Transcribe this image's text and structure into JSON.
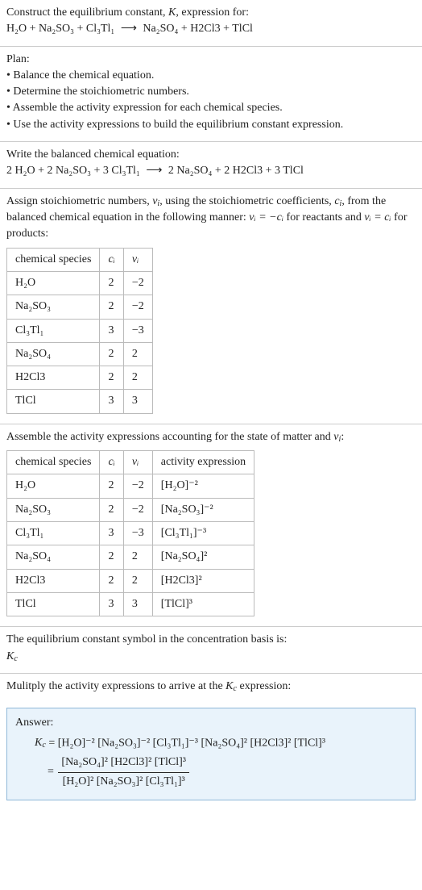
{
  "intro": {
    "line1_a": "Construct the equilibrium constant, ",
    "line1_k": "K",
    "line1_b": ", expression for:",
    "reaction_lhs": "H₂O + Na₂SO₃ + Cl₃Tl₁",
    "arrow": "⟶",
    "reaction_rhs": "Na₂SO₄ + H2Cl3 + TlCl"
  },
  "plan": {
    "title": "Plan:",
    "b1": "• Balance the chemical equation.",
    "b2": "• Determine the stoichiometric numbers.",
    "b3": "• Assemble the activity expression for each chemical species.",
    "b4": "• Use the activity expressions to build the equilibrium constant expression."
  },
  "balanced": {
    "title": "Write the balanced chemical equation:",
    "lhs": "2 H₂O + 2 Na₂SO₃ + 3 Cl₃Tl₁",
    "arrow": "⟶",
    "rhs": "2 Na₂SO₄ + 2 H2Cl3 + 3 TlCl"
  },
  "assign": {
    "line1_a": "Assign stoichiometric numbers, ",
    "line1_nu": "ν",
    "line1_i": "i",
    "line1_b": ", using the stoichiometric coefficients, ",
    "line1_c": "c",
    "line1_d": ", from the balanced chemical equation in the following manner: ",
    "rel1": "νᵢ = −cᵢ",
    "line1_e": " for reactants and ",
    "rel2": "νᵢ = cᵢ",
    "line1_f": " for products:",
    "headers": {
      "sp": "chemical species",
      "c": "cᵢ",
      "nu": "νᵢ"
    },
    "rows": [
      {
        "sp": "H₂O",
        "c": "2",
        "nu": "−2"
      },
      {
        "sp": "Na₂SO₃",
        "c": "2",
        "nu": "−2"
      },
      {
        "sp": "Cl₃Tl₁",
        "c": "3",
        "nu": "−3"
      },
      {
        "sp": "Na₂SO₄",
        "c": "2",
        "nu": "2"
      },
      {
        "sp": "H2Cl3",
        "c": "2",
        "nu": "2"
      },
      {
        "sp": "TlCl",
        "c": "3",
        "nu": "3"
      }
    ]
  },
  "activity": {
    "title_a": "Assemble the activity expressions accounting for the state of matter and ",
    "title_nu": "ν",
    "title_i": "i",
    "title_b": ":",
    "headers": {
      "sp": "chemical species",
      "c": "cᵢ",
      "nu": "νᵢ",
      "act": "activity expression"
    },
    "rows": [
      {
        "sp": "H₂O",
        "c": "2",
        "nu": "−2",
        "act": "[H₂O]⁻²"
      },
      {
        "sp": "Na₂SO₃",
        "c": "2",
        "nu": "−2",
        "act": "[Na₂SO₃]⁻²"
      },
      {
        "sp": "Cl₃Tl₁",
        "c": "3",
        "nu": "−3",
        "act": "[Cl₃Tl₁]⁻³"
      },
      {
        "sp": "Na₂SO₄",
        "c": "2",
        "nu": "2",
        "act": "[Na₂SO₄]²"
      },
      {
        "sp": "H2Cl3",
        "c": "2",
        "nu": "2",
        "act": "[H2Cl3]²"
      },
      {
        "sp": "TlCl",
        "c": "3",
        "nu": "3",
        "act": "[TlCl]³"
      }
    ]
  },
  "kc_symbol": {
    "line": "The equilibrium constant symbol in the concentration basis is:",
    "kc_k": "K",
    "kc_c": "c"
  },
  "multiply": {
    "line_a": "Mulitply the activity expressions to arrive at the ",
    "kc_k": "K",
    "kc_c": "c",
    "line_b": " expression:"
  },
  "answer": {
    "title": "Answer:",
    "lhs_k": "K",
    "lhs_c": "c",
    "eq": " = ",
    "long": "[H₂O]⁻² [Na₂SO₃]⁻² [Cl₃Tl₁]⁻³ [Na₂SO₄]² [H2Cl3]² [TlCl]³",
    "eq2": "= ",
    "num": "[Na₂SO₄]² [H2Cl3]² [TlCl]³",
    "den": "[H₂O]² [Na₂SO₃]² [Cl₃Tl₁]³"
  }
}
